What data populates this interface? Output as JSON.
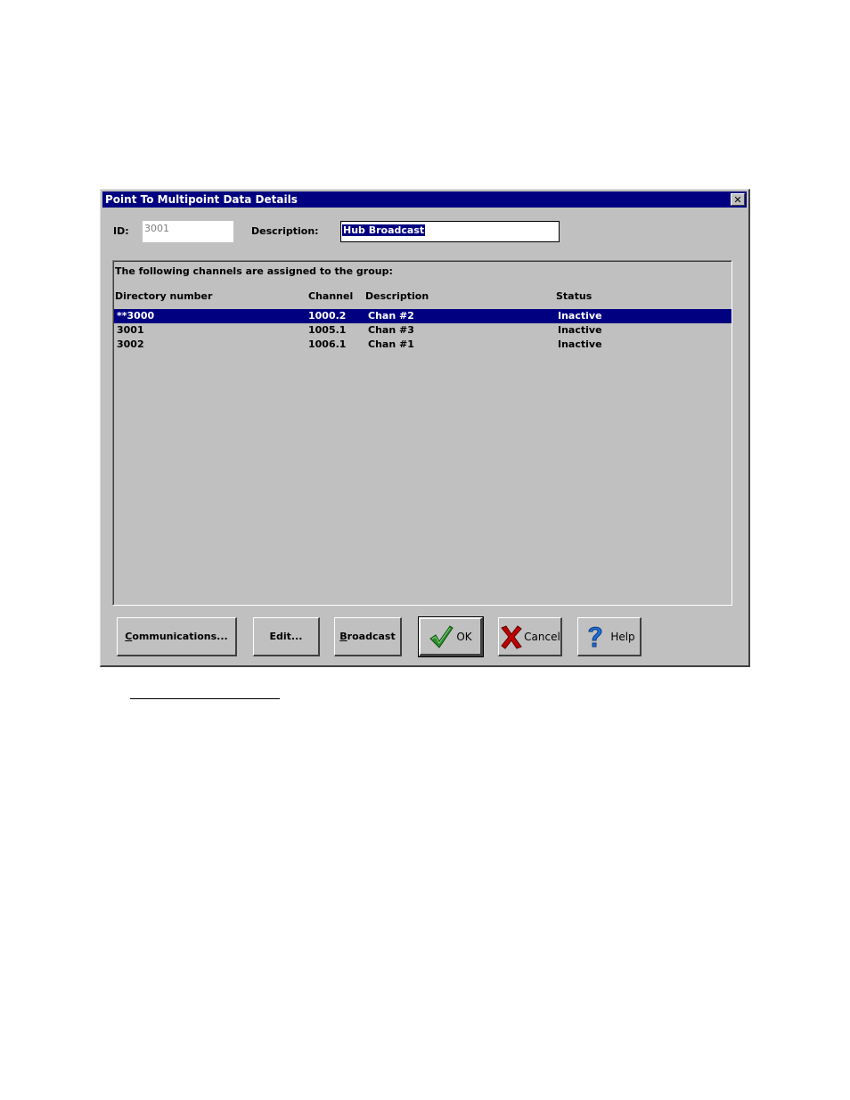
{
  "window": {
    "title": "Point To Multipoint Data Details",
    "close_glyph": "✕"
  },
  "form": {
    "id_label": "ID:",
    "id_value": "3001",
    "description_label": "Description:",
    "description_value": "Hub Broadcast"
  },
  "list": {
    "caption": "The following channels are assigned to the group:",
    "columns": [
      "Directory number",
      "Channel",
      "Description",
      "Status"
    ],
    "rows": [
      {
        "directory": "**3000",
        "channel": "1000.2",
        "description": "Chan #2",
        "status": "Inactive",
        "selected": true
      },
      {
        "directory": "3001",
        "channel": "1005.1",
        "description": "Chan #3",
        "status": "Inactive",
        "selected": false
      },
      {
        "directory": "3002",
        "channel": "1006.1",
        "description": "Chan #1",
        "status": "Inactive",
        "selected": false
      }
    ]
  },
  "buttons": {
    "communications": {
      "mnemonic": "C",
      "rest": "ommunications..."
    },
    "edit": "Edit...",
    "broadcast": {
      "mnemonic": "B",
      "rest": "roadcast"
    },
    "ok": "OK",
    "cancel": "Cancel",
    "help": "Help"
  },
  "colors": {
    "titlebar": "#000080",
    "selection": "#000080",
    "face": "#c0c0c0",
    "ok_check": "#2e8b2e",
    "cancel_x": "#c00000",
    "help_q": "#1e6fd9"
  },
  "icons": {
    "ok": "checkmark-icon",
    "cancel": "red-x-icon",
    "help": "question-mark-icon",
    "close": "close-icon"
  }
}
